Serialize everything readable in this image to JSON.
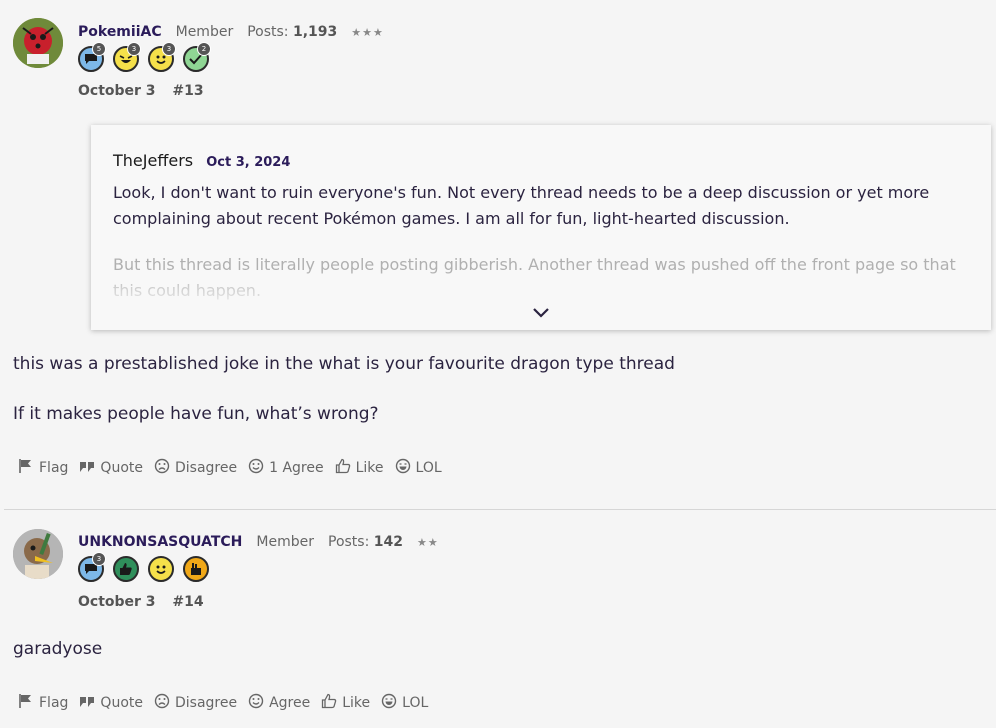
{
  "comments": [
    {
      "username": "PokemiiAC",
      "role": "Member",
      "posts_label": "Posts:",
      "posts_count": "1,193",
      "stars": "★★★",
      "badges": [
        {
          "icon": "speech-bubble-icon",
          "count": "5",
          "color": "#7db8e8"
        },
        {
          "icon": "laughing-face-icon",
          "count": "3",
          "color": "#f5e04a"
        },
        {
          "icon": "smile-face-icon",
          "count": "3",
          "color": "#f5e04a"
        },
        {
          "icon": "checkmark-icon",
          "count": "2",
          "color": "#8fd694"
        }
      ],
      "date": "October 3",
      "number": "#13",
      "quote": {
        "author": "TheJeffers",
        "date": "Oct 3, 2024",
        "paragraph1": "Look, I don't want to ruin everyone's fun. Not every thread needs to be a deep discussion or yet more complaining about recent Pokémon games. I am all for fun, light-hearted discussion.",
        "paragraph2": "But this thread is literally people posting gibberish. Another thread was pushed off the front page so that this could happen."
      },
      "body": [
        "this was a prestablished joke in the what is your favourite dragon type thread",
        "If it makes people have fun, what’s wrong?"
      ],
      "actions": {
        "flag": "Flag",
        "quote": "Quote",
        "disagree": "Disagree",
        "agree": "1 Agree",
        "like": "Like",
        "lol": "LOL"
      }
    },
    {
      "username": "UNKNONSASQUATCH",
      "role": "Member",
      "posts_label": "Posts:",
      "posts_count": "142",
      "stars": "★★",
      "badges": [
        {
          "icon": "speech-bubble-icon",
          "count": "3",
          "color": "#7db8e8"
        },
        {
          "icon": "thumbs-up-icon",
          "count": "",
          "color": "#2f8f5b"
        },
        {
          "icon": "smile-face-icon",
          "count": "",
          "color": "#f5e04a"
        },
        {
          "icon": "hand-icon",
          "count": "",
          "color": "#f0a818"
        }
      ],
      "date": "October 3",
      "number": "#14",
      "body": [
        "garadyose"
      ],
      "actions": {
        "flag": "Flag",
        "quote": "Quote",
        "disagree": "Disagree",
        "agree": "Agree",
        "like": "Like",
        "lol": "LOL"
      }
    }
  ]
}
